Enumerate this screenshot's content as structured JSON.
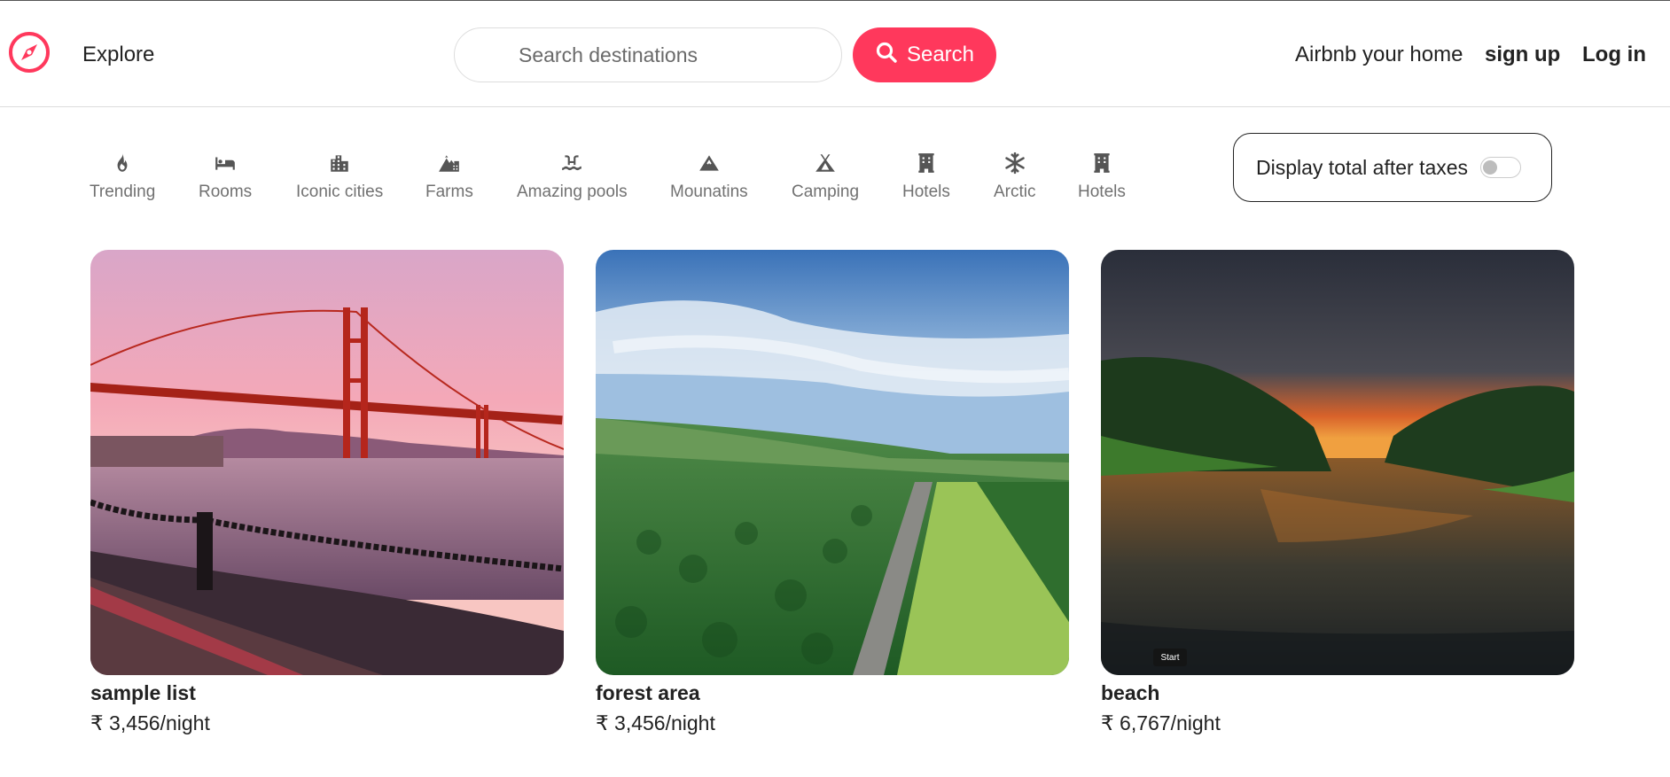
{
  "nav": {
    "explore_label": "Explore",
    "search_placeholder": "Search destinations",
    "search_button_label": "Search",
    "host_label": "Airbnb your home",
    "signup_label": "sign up",
    "login_label": "Log in"
  },
  "colors": {
    "brand": "#ff385c",
    "text": "#222222",
    "muted": "#717171"
  },
  "filters": [
    {
      "label": "Trending",
      "icon": "fire-icon"
    },
    {
      "label": "Rooms",
      "icon": "bed-icon"
    },
    {
      "label": "Iconic cities",
      "icon": "city-icon"
    },
    {
      "label": "Farms",
      "icon": "mountain-city-icon"
    },
    {
      "label": "Amazing pools",
      "icon": "pool-icon"
    },
    {
      "label": "Mounatins",
      "icon": "mountain-icon"
    },
    {
      "label": "Camping",
      "icon": "tent-icon"
    },
    {
      "label": "Hotels",
      "icon": "hotel-icon"
    },
    {
      "label": "Arctic",
      "icon": "snowflake-icon"
    },
    {
      "label": "Hotels",
      "icon": "hotel-icon"
    }
  ],
  "tax_toggle": {
    "label": "Display total after taxes",
    "enabled": false
  },
  "listings": [
    {
      "title": "sample list",
      "price": "₹ 3,456/night",
      "image": "golden-gate-bridge-sunset"
    },
    {
      "title": "forest area",
      "price": "₹ 3,456/night",
      "image": "forest-road-aerial"
    },
    {
      "title": "beach",
      "price": "₹ 6,767/night",
      "image": "river-sunset-forest",
      "overlay_label": "Start"
    }
  ]
}
